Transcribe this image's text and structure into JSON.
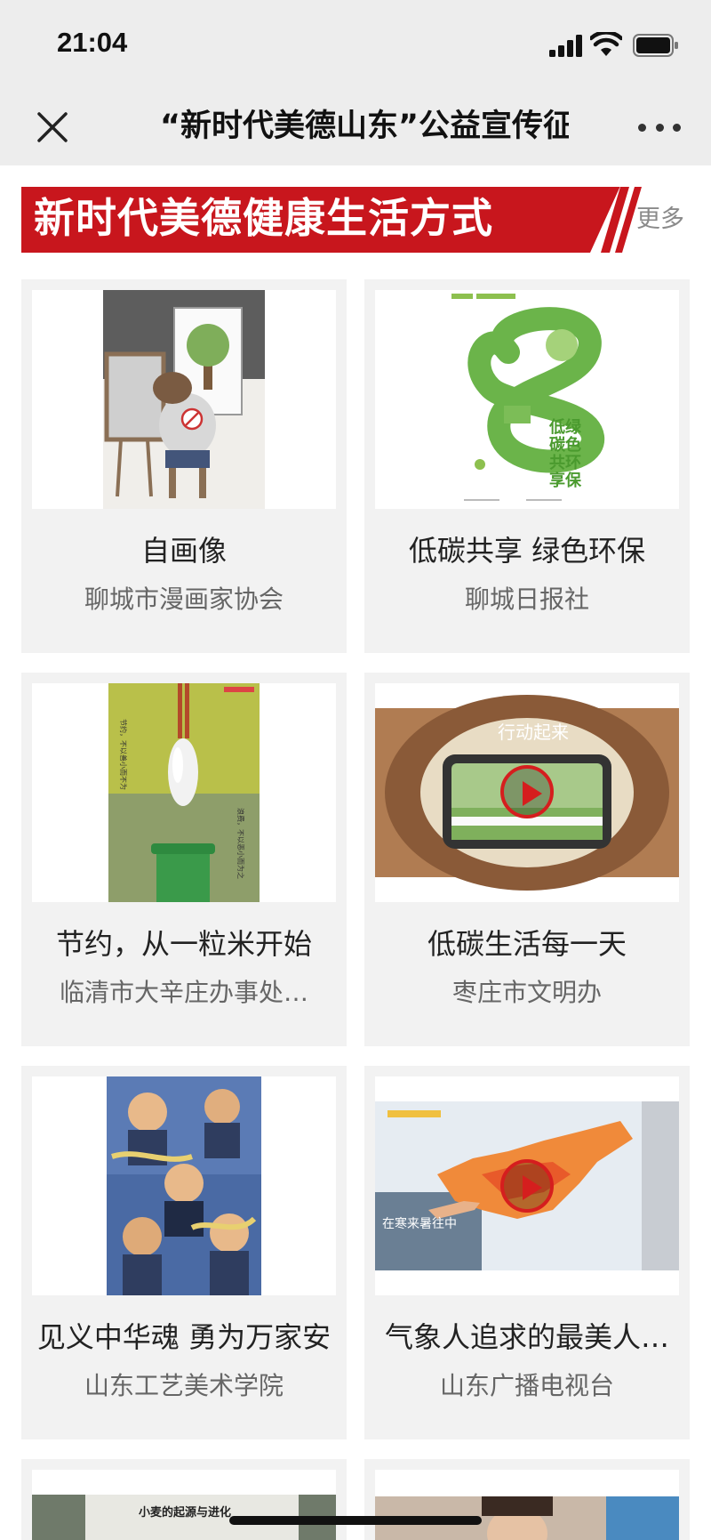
{
  "status": {
    "time": "21:04"
  },
  "nav": {
    "title": "“新时代美德山东”公益宣传征"
  },
  "banner": {
    "title": "新时代美德健康生活方式",
    "more": "更多 >"
  },
  "cards": [
    {
      "title": "自画像",
      "source": "聊城市漫画家协会",
      "media": "image"
    },
    {
      "title": "低碳共享 绿色环保",
      "source": "聊城日报社",
      "media": "image"
    },
    {
      "title": "节约，从一粒米开始",
      "source": "临清市大辛庄办事处…",
      "media": "image"
    },
    {
      "title": "低碳生活每一天",
      "source": "枣庄市文明办",
      "media": "video"
    },
    {
      "title": "见义中华魂 勇为万家安",
      "source": "山东工艺美术学院",
      "media": "image"
    },
    {
      "title": "气象人追求的最美人…",
      "source": "山东广播电视台",
      "media": "video"
    }
  ],
  "poster_text": {
    "green": [
      "低绿",
      "碳色",
      "共环",
      "享保"
    ],
    "rice_top": "节约，不以善小而不为",
    "rice_bottom": "浪费，不以恶小而为之",
    "video1": "行动起来",
    "video2_caption": "在寒来暑往中",
    "video3_heading": "小麦的起源与进化"
  },
  "colors": {
    "banner_red": "#c8161d",
    "card_bg": "#f2f2f2",
    "bar_bg": "#ededed"
  }
}
